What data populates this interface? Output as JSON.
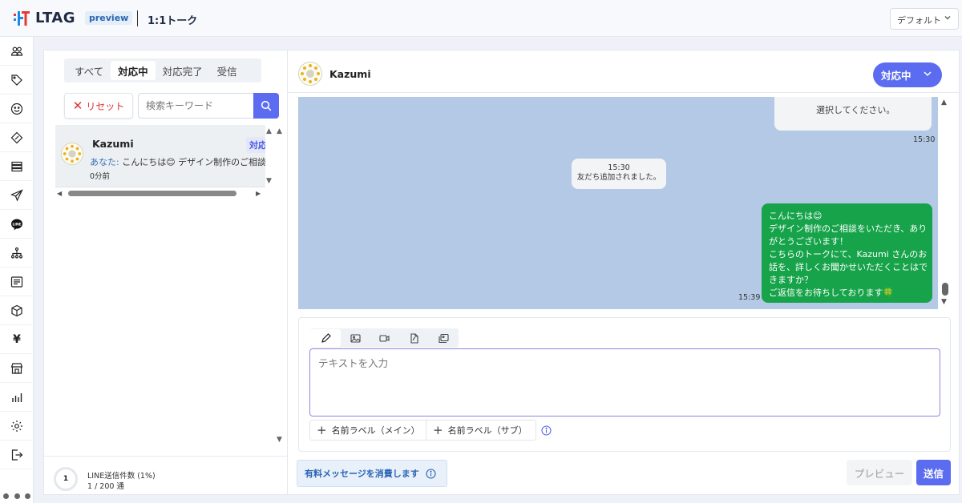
{
  "header": {
    "logo_text": "LTAG",
    "preview_badge": "preview",
    "page_title": "1:1トーク",
    "default_select": "デフォルト"
  },
  "sidebar": {
    "items": [
      {
        "icon": "users-icon"
      },
      {
        "icon": "tag-icon"
      },
      {
        "icon": "smile-icon"
      },
      {
        "icon": "ticket-icon"
      },
      {
        "icon": "list-icon"
      },
      {
        "icon": "send-icon"
      },
      {
        "icon": "line-icon"
      },
      {
        "icon": "sitemap-icon"
      },
      {
        "icon": "message-icon"
      },
      {
        "icon": "box-icon"
      },
      {
        "icon": "yen-icon"
      },
      {
        "icon": "store-icon"
      },
      {
        "icon": "bar-chart-icon"
      },
      {
        "icon": "gear-icon"
      },
      {
        "icon": "logout-icon"
      }
    ],
    "line_label": "LINE",
    "yen_label": "¥"
  },
  "left_panel": {
    "tabs": [
      {
        "label": "すべて",
        "active": false
      },
      {
        "label": "対応中",
        "active": true
      },
      {
        "label": "対応完了",
        "active": false
      },
      {
        "label": "受信",
        "active": false
      }
    ],
    "reset_label": "リセット",
    "search_placeholder": "検索キーワード",
    "conversations": [
      {
        "name": "Kazumi",
        "status": "対応",
        "preview_prefix": "あなた:",
        "preview_text": " こんにちは😊 デザイン制作のご相談を",
        "time": "0分前"
      }
    ],
    "quota": {
      "ring_value": "1",
      "label": "LINE送信件数 (1%)",
      "count": "1 / 200 通"
    }
  },
  "chat": {
    "contact_name": "Kazumi",
    "status_label": "対応中",
    "messages": {
      "top_bubble_text": "選択してください。",
      "top_time": "15:30",
      "system_time": "15:30",
      "system_text": "友だち追加されました。",
      "green_lines": [
        "こんにちは😊",
        "デザイン制作のご相談をいただき、あり",
        "がとうございます！",
        "こちらのトークにて、Kazumi さんのお",
        "話を、詳しくお聞かせいただくことはで",
        "きますか？",
        "ご返信をお待ちしております🍀"
      ],
      "green_time": "15:39"
    },
    "composer": {
      "tools": [
        {
          "icon": "pencil-icon",
          "active": true
        },
        {
          "icon": "image-icon",
          "active": false
        },
        {
          "icon": "video-icon",
          "active": false
        },
        {
          "icon": "pdf-icon",
          "active": false
        },
        {
          "icon": "gallery-icon",
          "active": false
        }
      ],
      "placeholder": "テキストを入力",
      "label_main": "名前ラベル（メイン）",
      "label_sub": "名前ラベル（サブ）"
    },
    "footer": {
      "paid_message": "有料メッセージを消費します",
      "preview_label": "プレビュー",
      "send_label": "送信"
    }
  },
  "colors": {
    "accent": "#5b6cf0",
    "chat_bg": "#b3c9e6",
    "sent_bubble": "#16a34a",
    "reset_red": "#dd3333"
  }
}
